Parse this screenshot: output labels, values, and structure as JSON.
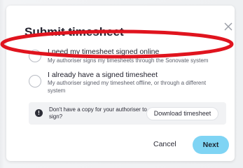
{
  "dialog": {
    "title": "Submit timesheet",
    "close_icon": "close-icon"
  },
  "options": [
    {
      "title": "I need my timesheet signed online",
      "description": "My authoriser signs my timesheets through the Sonovate system",
      "selected": false
    },
    {
      "title": "I already have a signed timesheet",
      "description": "My authoriser signed my timesheet offline, or through a different system",
      "selected": false
    }
  ],
  "info": {
    "icon": "exclamation-icon",
    "text": "Don't have a copy for your authoriser to sign?",
    "download_label": "Download timesheet"
  },
  "footer": {
    "cancel_label": "Cancel",
    "next_label": "Next"
  },
  "colors": {
    "primary_button": "#7fd4f4",
    "highlight_ellipse": "#e0141e",
    "backdrop": "#eef0f2"
  }
}
